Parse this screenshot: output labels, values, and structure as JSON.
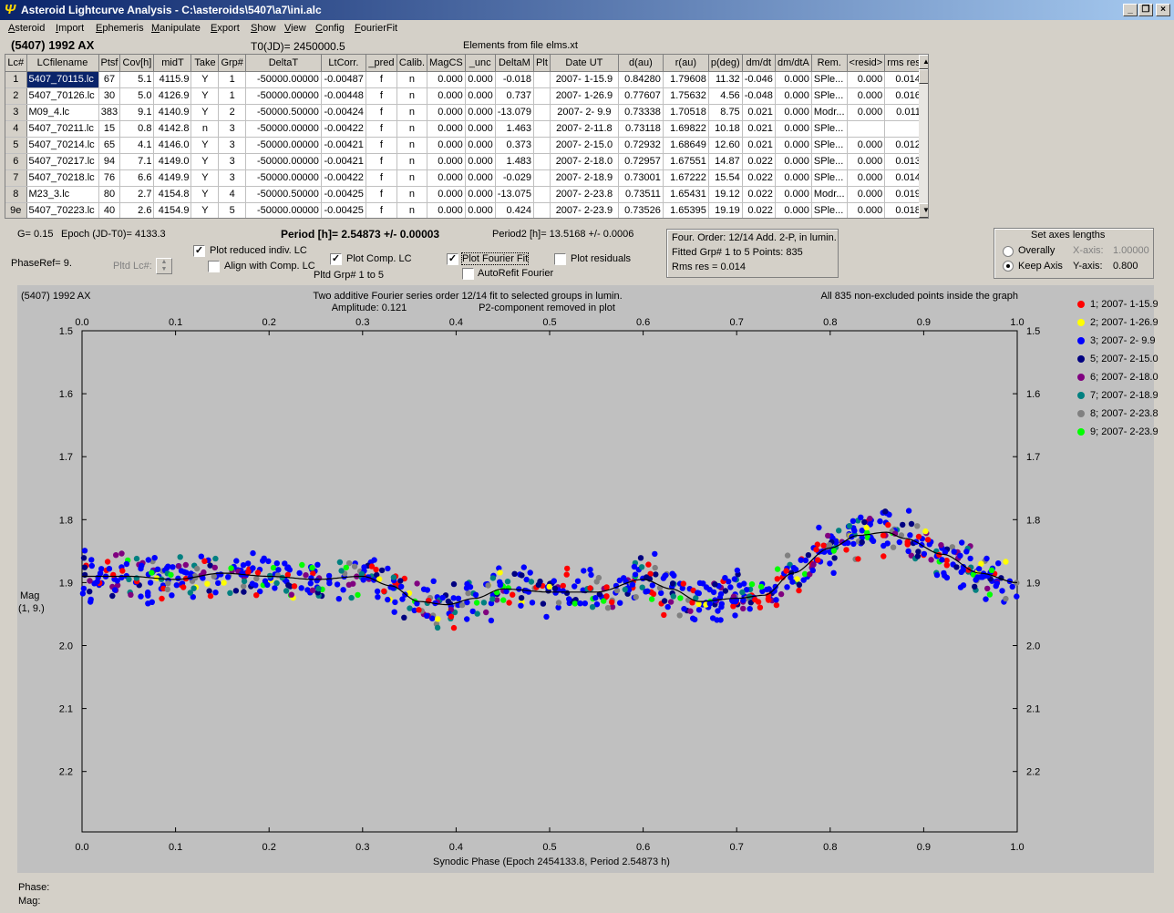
{
  "window": {
    "title": "Asteroid Lightcurve Analysis - C:\\asteroids\\5407\\a7\\ini.alc",
    "min": "_",
    "max": "❐",
    "close": "×"
  },
  "menu": [
    "Asteroid",
    "Import",
    "Ephemeris",
    "Manipulate",
    "Export",
    "Show",
    "View",
    "Config",
    "FourierFit"
  ],
  "header": {
    "asteroid": "(5407) 1992 AX",
    "t0": "T0(JD)= 2450000.5",
    "elements": "Elements from file elms.xt"
  },
  "table": {
    "columns": [
      "Lc#",
      "LCfilename",
      "Ptsf",
      "Cov[h]",
      "midT",
      "Take",
      "Grp#",
      "DeltaT",
      "LtCorr.",
      "_pred",
      "Calib.",
      "MagCS",
      "_unc",
      "DeltaM",
      "Plt",
      "Date UT",
      "d(au)",
      "r(au)",
      "p(deg)",
      "dm/dt",
      "dm/dtA",
      "Rem.",
      "<resid>",
      "rms res"
    ],
    "rows": [
      [
        "1",
        "5407_70115.lc",
        "67",
        "5.1",
        "4115.9",
        "Y",
        "1",
        "-50000.00000",
        "-0.00487",
        "f",
        "n",
        "0.000",
        "0.000",
        "-0.018",
        "",
        "2007- 1-15.9",
        "0.84280",
        "1.79608",
        "11.32",
        "-0.046",
        "0.000",
        "SPle...",
        "0.000",
        "0.014"
      ],
      [
        "2",
        "5407_70126.lc",
        "30",
        "5.0",
        "4126.9",
        "Y",
        "1",
        "-50000.00000",
        "-0.00448",
        "f",
        "n",
        "0.000",
        "0.000",
        "0.737",
        "",
        "2007- 1-26.9",
        "0.77607",
        "1.75632",
        "4.56",
        "-0.048",
        "0.000",
        "SPle...",
        "0.000",
        "0.016"
      ],
      [
        "3",
        "M09_4.lc",
        "383",
        "9.1",
        "4140.9",
        "Y",
        "2",
        "-50000.50000",
        "-0.00424",
        "f",
        "n",
        "0.000",
        "0.000",
        "-13.079",
        "",
        "2007- 2- 9.9",
        "0.73338",
        "1.70518",
        "8.75",
        "0.021",
        "0.000",
        "Modr...",
        "0.000",
        "0.011"
      ],
      [
        "4",
        "5407_70211.lc",
        "15",
        "0.8",
        "4142.8",
        "n",
        "3",
        "-50000.00000",
        "-0.00422",
        "f",
        "n",
        "0.000",
        "0.000",
        "1.463",
        "",
        "2007- 2-11.8",
        "0.73118",
        "1.69822",
        "10.18",
        "0.021",
        "0.000",
        "SPle...",
        "",
        ""
      ],
      [
        "5",
        "5407_70214.lc",
        "65",
        "4.1",
        "4146.0",
        "Y",
        "3",
        "-50000.00000",
        "-0.00421",
        "f",
        "n",
        "0.000",
        "0.000",
        "0.373",
        "",
        "2007- 2-15.0",
        "0.72932",
        "1.68649",
        "12.60",
        "0.021",
        "0.000",
        "SPle...",
        "0.000",
        "0.012"
      ],
      [
        "6",
        "5407_70217.lc",
        "94",
        "7.1",
        "4149.0",
        "Y",
        "3",
        "-50000.00000",
        "-0.00421",
        "f",
        "n",
        "0.000",
        "0.000",
        "1.483",
        "",
        "2007- 2-18.0",
        "0.72957",
        "1.67551",
        "14.87",
        "0.022",
        "0.000",
        "SPle...",
        "0.000",
        "0.013"
      ],
      [
        "7",
        "5407_70218.lc",
        "76",
        "6.6",
        "4149.9",
        "Y",
        "3",
        "-50000.00000",
        "-0.00422",
        "f",
        "n",
        "0.000",
        "0.000",
        "-0.029",
        "",
        "2007- 2-18.9",
        "0.73001",
        "1.67222",
        "15.54",
        "0.022",
        "0.000",
        "SPle...",
        "0.000",
        "0.014"
      ],
      [
        "8",
        "M23_3.lc",
        "80",
        "2.7",
        "4154.8",
        "Y",
        "4",
        "-50000.50000",
        "-0.00425",
        "f",
        "n",
        "0.000",
        "0.000",
        "-13.075",
        "",
        "2007- 2-23.8",
        "0.73511",
        "1.65431",
        "19.12",
        "0.022",
        "0.000",
        "Modr...",
        "0.000",
        "0.019"
      ],
      [
        "9e",
        "5407_70223.lc",
        "40",
        "2.6",
        "4154.9",
        "Y",
        "5",
        "-50000.00000",
        "-0.00425",
        "f",
        "n",
        "0.000",
        "0.000",
        "0.424",
        "",
        "2007- 2-23.9",
        "0.73526",
        "1.65395",
        "19.19",
        "0.022",
        "0.000",
        "SPle...",
        "0.000",
        "0.018"
      ]
    ]
  },
  "controls": {
    "g": "G= 0.15",
    "epoch": "Epoch (JD-T0)= 4133.3",
    "period": "Period [h]= 2.54873 +/- 0.00003",
    "period2": "Period2 [h]= 13.5168 +/- 0.0006",
    "phaseref": "PhaseRef= 9.",
    "pltd_lc": "Pltd Lc#:",
    "plot_reduced": "Plot reduced indiv. LC",
    "align_comp": "Align with Comp. LC",
    "plot_comp": "Plot Comp. LC",
    "pltd_grp": "Pltd Grp#  1   to   5",
    "plot_fourier": "Plot Fourier Fit",
    "autorefit": "AutoRefit Fourier",
    "plot_residuals": "Plot residuals",
    "check_glyph": "✓"
  },
  "fourier_info": {
    "line1": "Four. Order: 12/14    Add. 2-P, in lumin.",
    "line2": "Fitted Grp# 1 to 5      Points: 835",
    "line3": "Rms res      = 0.014"
  },
  "axes_box": {
    "title": "Set axes lengths",
    "overally": "Overally",
    "keep_axis": "Keep Axis",
    "xaxis_label": "X-axis:",
    "xaxis_value": "1.00000",
    "yaxis_label": "Y-axis:",
    "yaxis_value": "0.800"
  },
  "plot": {
    "corner_title": "(5407) 1992 AX",
    "center_line1": "Two additive Fourier series order 12/14 fit to selected groups in lumin.",
    "center_line2a": "Amplitude: 0.121",
    "center_line2b": "P2-component removed in plot",
    "right_note": "All 835 non-excluded points inside the graph",
    "ylabel1": "Mag",
    "ylabel2": "(1, 9.)",
    "xlabel": "Synodic Phase (Epoch 2454133.8, Period 2.54873 h)"
  },
  "chart_data": {
    "type": "scatter",
    "xlim": [
      0.0,
      1.0
    ],
    "ylim": [
      1.5,
      2.3
    ],
    "y_inverted": true,
    "x_ticks": [
      "0.0",
      "0.1",
      "0.2",
      "0.3",
      "0.4",
      "0.5",
      "0.6",
      "0.7",
      "0.8",
      "0.9",
      "1.0"
    ],
    "y_ticks": [
      "1.5",
      "1.6",
      "1.7",
      "1.8",
      "1.9",
      "2.0",
      "2.1",
      "2.2"
    ],
    "fit_curve": {
      "x": [
        0.0,
        0.05,
        0.1,
        0.15,
        0.2,
        0.25,
        0.3,
        0.33,
        0.36,
        0.39,
        0.42,
        0.45,
        0.5,
        0.55,
        0.6,
        0.63,
        0.66,
        0.7,
        0.73,
        0.76,
        0.8,
        0.83,
        0.86,
        0.88,
        0.92,
        0.96,
        1.0
      ],
      "y": [
        1.89,
        1.89,
        1.895,
        1.885,
        1.89,
        1.895,
        1.89,
        1.905,
        1.93,
        1.935,
        1.925,
        1.91,
        1.915,
        1.915,
        1.895,
        1.91,
        1.93,
        1.925,
        1.92,
        1.885,
        1.845,
        1.825,
        1.82,
        1.83,
        1.855,
        1.885,
        1.9
      ]
    },
    "scatter_spread": 0.018,
    "point_count": 835,
    "series": [
      {
        "name": "1; 2007- 1-15.9",
        "color": "#ff0000"
      },
      {
        "name": "2; 2007- 1-26.9",
        "color": "#ffff00"
      },
      {
        "name": "3; 2007- 2- 9.9",
        "color": "#0000ff"
      },
      {
        "name": "5; 2007- 2-15.0",
        "color": "#000080"
      },
      {
        "name": "6; 2007- 2-18.0",
        "color": "#800080"
      },
      {
        "name": "7; 2007- 2-18.9",
        "color": "#008080"
      },
      {
        "name": "8; 2007- 2-23.8",
        "color": "#808080"
      },
      {
        "name": "9; 2007- 2-23.9",
        "color": "#00ff00"
      }
    ]
  },
  "status": {
    "phase": "Phase:",
    "mag": "Mag:"
  }
}
